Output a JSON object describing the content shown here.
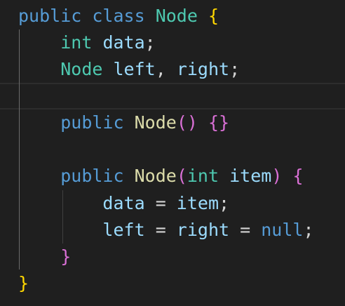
{
  "editor": {
    "language": "java",
    "colors": {
      "background": "#1f1f1f",
      "keyword": "#569cd6",
      "type": "#4ec9b0",
      "function": "#dcdcaa",
      "variable": "#9cdcfe",
      "punctuation": "#d4d4d4",
      "bracket_level_1": "#ffd700",
      "bracket_level_2": "#da70d6"
    },
    "lines": [
      {
        "tokens": [
          {
            "text": "public",
            "kind": "kw"
          },
          {
            "text": " ",
            "kind": "pu"
          },
          {
            "text": "class",
            "kind": "kw"
          },
          {
            "text": " ",
            "kind": "pu"
          },
          {
            "text": "Node",
            "kind": "ty"
          },
          {
            "text": " ",
            "kind": "pu"
          },
          {
            "text": "{",
            "kind": "b1"
          }
        ]
      },
      {
        "tokens": [
          {
            "text": "    ",
            "kind": "pu"
          },
          {
            "text": "int",
            "kind": "ty"
          },
          {
            "text": " ",
            "kind": "pu"
          },
          {
            "text": "data",
            "kind": "var"
          },
          {
            "text": ";",
            "kind": "pu"
          }
        ]
      },
      {
        "tokens": [
          {
            "text": "    ",
            "kind": "pu"
          },
          {
            "text": "Node",
            "kind": "ty"
          },
          {
            "text": " ",
            "kind": "pu"
          },
          {
            "text": "left",
            "kind": "var"
          },
          {
            "text": ", ",
            "kind": "pu"
          },
          {
            "text": "right",
            "kind": "var"
          },
          {
            "text": ";",
            "kind": "pu"
          }
        ]
      },
      {
        "tokens": []
      },
      {
        "tokens": [
          {
            "text": "    ",
            "kind": "pu"
          },
          {
            "text": "public",
            "kind": "kw"
          },
          {
            "text": " ",
            "kind": "pu"
          },
          {
            "text": "Node",
            "kind": "fn"
          },
          {
            "text": "()",
            "kind": "b2"
          },
          {
            "text": " ",
            "kind": "pu"
          },
          {
            "text": "{}",
            "kind": "b2"
          }
        ]
      },
      {
        "tokens": []
      },
      {
        "tokens": [
          {
            "text": "    ",
            "kind": "pu"
          },
          {
            "text": "public",
            "kind": "kw"
          },
          {
            "text": " ",
            "kind": "pu"
          },
          {
            "text": "Node",
            "kind": "fn"
          },
          {
            "text": "(",
            "kind": "b2"
          },
          {
            "text": "int",
            "kind": "ty"
          },
          {
            "text": " ",
            "kind": "pu"
          },
          {
            "text": "item",
            "kind": "var"
          },
          {
            "text": ")",
            "kind": "b2"
          },
          {
            "text": " ",
            "kind": "pu"
          },
          {
            "text": "{",
            "kind": "b2"
          }
        ]
      },
      {
        "tokens": [
          {
            "text": "        ",
            "kind": "pu"
          },
          {
            "text": "data",
            "kind": "var"
          },
          {
            "text": " = ",
            "kind": "pu"
          },
          {
            "text": "item",
            "kind": "var"
          },
          {
            "text": ";",
            "kind": "pu"
          }
        ]
      },
      {
        "tokens": [
          {
            "text": "        ",
            "kind": "pu"
          },
          {
            "text": "left",
            "kind": "var"
          },
          {
            "text": " = ",
            "kind": "pu"
          },
          {
            "text": "right",
            "kind": "var"
          },
          {
            "text": " = ",
            "kind": "pu"
          },
          {
            "text": "null",
            "kind": "kw"
          },
          {
            "text": ";",
            "kind": "pu"
          }
        ]
      },
      {
        "tokens": [
          {
            "text": "    ",
            "kind": "pu"
          },
          {
            "text": "}",
            "kind": "b2"
          }
        ]
      },
      {
        "tokens": [
          {
            "text": "}",
            "kind": "b1"
          }
        ]
      }
    ]
  }
}
